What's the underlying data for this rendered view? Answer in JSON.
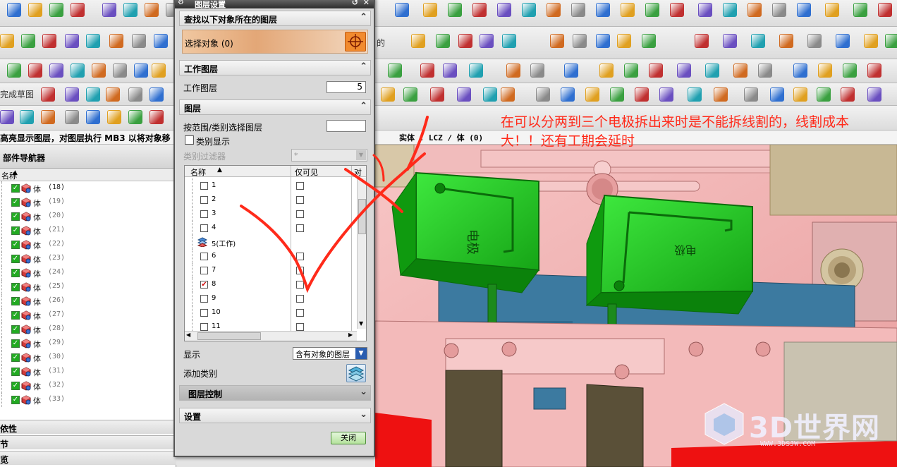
{
  "toolbar": {
    "row2_label": "的",
    "row4_label": "完成草图"
  },
  "status": {
    "left": "高亮显示图层，对图层执行 MB3 以将对象移",
    "right": "实体 : LCZ / 体 (0)"
  },
  "navigator": {
    "title": "部件导航器",
    "col_head": "名称",
    "rows": [
      {
        "label": "体",
        "num": "(18)"
      },
      {
        "label": "体",
        "num": "(19)"
      },
      {
        "label": "体",
        "num": "(20)"
      },
      {
        "label": "体",
        "num": "(21)"
      },
      {
        "label": "体",
        "num": "(22)"
      },
      {
        "label": "体",
        "num": "(23)"
      },
      {
        "label": "体",
        "num": "(24)"
      },
      {
        "label": "体",
        "num": "(25)"
      },
      {
        "label": "体",
        "num": "(26)"
      },
      {
        "label": "体",
        "num": "(27)"
      },
      {
        "label": "体",
        "num": "(28)"
      },
      {
        "label": "体",
        "num": "(29)"
      },
      {
        "label": "体",
        "num": "(30)"
      },
      {
        "label": "体",
        "num": "(31)"
      },
      {
        "label": "体",
        "num": "(32)"
      },
      {
        "label": "体",
        "num": "(33)"
      }
    ],
    "footer1": "依性",
    "footer2": "节",
    "footer3": "览"
  },
  "dialog": {
    "title": "图层设置",
    "find_group": "查找以下对象所在的图层",
    "select_object": "选择对象 (0)",
    "work_layer_group": "工作图层",
    "work_layer_label": "工作图层",
    "work_layer_value": "5",
    "layer_group": "图层",
    "range_label": "按范围/类别选择图层",
    "category_display": "类别显示",
    "category_filter": "类别过滤器",
    "category_filter_value": "*",
    "col_name": "名称",
    "col_visible_only": "仅可见",
    "col_objects": "对",
    "layers": [
      {
        "name": "1",
        "checked": false,
        "vis": true
      },
      {
        "name": "2",
        "checked": false,
        "vis": true
      },
      {
        "name": "3",
        "checked": false,
        "vis": true
      },
      {
        "name": "4",
        "checked": false,
        "vis": true
      },
      {
        "name": "5(工作)",
        "checked": false,
        "vis": false,
        "work": true
      },
      {
        "name": "6",
        "checked": false,
        "vis": true
      },
      {
        "name": "7",
        "checked": false,
        "vis": true
      },
      {
        "name": "8",
        "checked": true,
        "vis": true
      },
      {
        "name": "9",
        "checked": false,
        "vis": true
      },
      {
        "name": "10",
        "checked": false,
        "vis": true
      },
      {
        "name": "11",
        "checked": false,
        "vis": true
      }
    ],
    "display_label": "显示",
    "display_value": "含有对象的图层",
    "add_category": "添加类别",
    "layer_control": "图层控制",
    "settings": "设置",
    "close": "关闭"
  },
  "annotation": {
    "line1": "在可以分两到三个电极拆出来时是不能拆线割的，线割成本",
    "line2": "大！！还有工期会延时"
  },
  "watermark": {
    "name": "3D世界网",
    "url": "WWW.3DSJW.COM"
  },
  "colors": {
    "accent_orange": "#f28b2e",
    "annotation_red": "#ff2a1a",
    "electrode_green": "#22cc22",
    "mold_pink": "#f2b4b4",
    "mold_steel_blue": "#3c7aa0"
  }
}
